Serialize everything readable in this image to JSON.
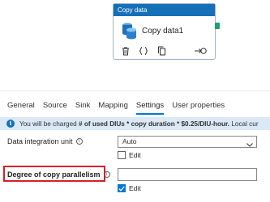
{
  "activity": {
    "type_label": "Copy data",
    "name": "Copy data1",
    "icons": [
      "database-copy-icon",
      "delete-icon",
      "code-braces-icon",
      "clone-icon",
      "next-activity-icon"
    ]
  },
  "tabs": [
    {
      "label": "General",
      "active": false
    },
    {
      "label": "Source",
      "active": false
    },
    {
      "label": "Sink",
      "active": false
    },
    {
      "label": "Mapping",
      "active": false
    },
    {
      "label": "Settings",
      "active": true
    },
    {
      "label": "User properties",
      "active": false
    }
  ],
  "info": {
    "prefix": "You will be charged ",
    "bold": "# of used DIUs * copy duration * $0.25/DIU-hour.",
    "suffix": " Local cur"
  },
  "settings": {
    "diu_label": "Data integration unit",
    "diu_value": "Auto",
    "diu_edit_label": "Edit",
    "parallel_label": "Degree of copy parallelism",
    "parallel_value": "",
    "parallel_edit_label": "Edit"
  },
  "colors": {
    "header_blue": "#1570b8",
    "accent": "#0078d4",
    "info_bg": "#dbe9f6",
    "highlight_red": "#d81e28",
    "port_green": "#22a06b"
  }
}
